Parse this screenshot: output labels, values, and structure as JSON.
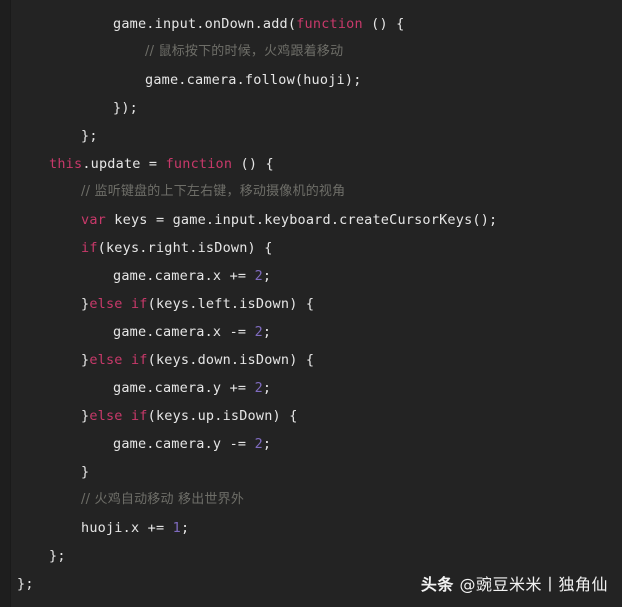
{
  "editor": {
    "background_color": "#232323",
    "default_text_color": "#e6e6e6",
    "keyword_color": "#c8396a",
    "number_color": "#7f6bbf",
    "comment_color": "#6e6e68",
    "language": "javascript"
  },
  "code_lines": [
    {
      "indent": 3,
      "kind": "code",
      "tokens": [
        {
          "text": "game.input.onDown.add(",
          "type": "plain"
        },
        {
          "text": "function",
          "type": "keyword"
        },
        {
          "text": " () {",
          "type": "plain"
        }
      ]
    },
    {
      "indent": 4,
      "kind": "comment",
      "tokens": [
        {
          "text": "// 鼠标按下的时候，火鸡跟着移动",
          "type": "comment"
        }
      ]
    },
    {
      "indent": 4,
      "kind": "code",
      "tokens": [
        {
          "text": "game.camera.follow(huoji);",
          "type": "plain"
        }
      ]
    },
    {
      "indent": 3,
      "kind": "code",
      "tokens": [
        {
          "text": "});",
          "type": "plain"
        }
      ]
    },
    {
      "indent": 2,
      "kind": "code",
      "tokens": [
        {
          "text": "};",
          "type": "plain"
        }
      ]
    },
    {
      "indent": 1,
      "kind": "code",
      "tokens": [
        {
          "text": "this",
          "type": "keyword"
        },
        {
          "text": ".update = ",
          "type": "plain"
        },
        {
          "text": "function",
          "type": "keyword"
        },
        {
          "text": " () {",
          "type": "plain"
        }
      ]
    },
    {
      "indent": 2,
      "kind": "comment",
      "tokens": [
        {
          "text": "// 监听键盘的上下左右键，移动摄像机的视角",
          "type": "comment"
        }
      ]
    },
    {
      "indent": 2,
      "kind": "code",
      "tokens": [
        {
          "text": "var",
          "type": "keyword"
        },
        {
          "text": " keys = game.input.keyboard.createCursorKeys();",
          "type": "plain"
        }
      ]
    },
    {
      "indent": 2,
      "kind": "code",
      "tokens": [
        {
          "text": "if",
          "type": "keyword"
        },
        {
          "text": "(keys.right.isDown) {",
          "type": "plain"
        }
      ]
    },
    {
      "indent": 3,
      "kind": "code",
      "tokens": [
        {
          "text": "game.camera.x += ",
          "type": "plain"
        },
        {
          "text": "2",
          "type": "number"
        },
        {
          "text": ";",
          "type": "plain"
        }
      ]
    },
    {
      "indent": 2,
      "kind": "code",
      "tokens": [
        {
          "text": "}",
          "type": "plain"
        },
        {
          "text": "else",
          "type": "keyword"
        },
        {
          "text": " ",
          "type": "plain"
        },
        {
          "text": "if",
          "type": "keyword"
        },
        {
          "text": "(keys.left.isDown) {",
          "type": "plain"
        }
      ]
    },
    {
      "indent": 3,
      "kind": "code",
      "tokens": [
        {
          "text": "game.camera.x -= ",
          "type": "plain"
        },
        {
          "text": "2",
          "type": "number"
        },
        {
          "text": ";",
          "type": "plain"
        }
      ]
    },
    {
      "indent": 2,
      "kind": "code",
      "tokens": [
        {
          "text": "}",
          "type": "plain"
        },
        {
          "text": "else",
          "type": "keyword"
        },
        {
          "text": " ",
          "type": "plain"
        },
        {
          "text": "if",
          "type": "keyword"
        },
        {
          "text": "(keys.down.isDown) {",
          "type": "plain"
        }
      ]
    },
    {
      "indent": 3,
      "kind": "code",
      "tokens": [
        {
          "text": "game.camera.y += ",
          "type": "plain"
        },
        {
          "text": "2",
          "type": "number"
        },
        {
          "text": ";",
          "type": "plain"
        }
      ]
    },
    {
      "indent": 2,
      "kind": "code",
      "tokens": [
        {
          "text": "}",
          "type": "plain"
        },
        {
          "text": "else",
          "type": "keyword"
        },
        {
          "text": " ",
          "type": "plain"
        },
        {
          "text": "if",
          "type": "keyword"
        },
        {
          "text": "(keys.up.isDown) {",
          "type": "plain"
        }
      ]
    },
    {
      "indent": 3,
      "kind": "code",
      "tokens": [
        {
          "text": "game.camera.y -= ",
          "type": "plain"
        },
        {
          "text": "2",
          "type": "number"
        },
        {
          "text": ";",
          "type": "plain"
        }
      ]
    },
    {
      "indent": 2,
      "kind": "code",
      "tokens": [
        {
          "text": "}",
          "type": "plain"
        }
      ]
    },
    {
      "indent": 2,
      "kind": "comment",
      "tokens": [
        {
          "text": "// 火鸡自动移动 移出世界外",
          "type": "comment"
        }
      ]
    },
    {
      "indent": 2,
      "kind": "code",
      "tokens": [
        {
          "text": "huoji.x += ",
          "type": "plain"
        },
        {
          "text": "1",
          "type": "number"
        },
        {
          "text": ";",
          "type": "plain"
        }
      ]
    },
    {
      "indent": 1,
      "kind": "code",
      "tokens": [
        {
          "text": "};",
          "type": "plain"
        }
      ]
    },
    {
      "indent": 0,
      "kind": "code",
      "tokens": [
        {
          "text": "};",
          "type": "plain"
        }
      ]
    }
  ],
  "watermark": {
    "brand": "头条",
    "handle": " @豌豆米米丨独角仙"
  }
}
